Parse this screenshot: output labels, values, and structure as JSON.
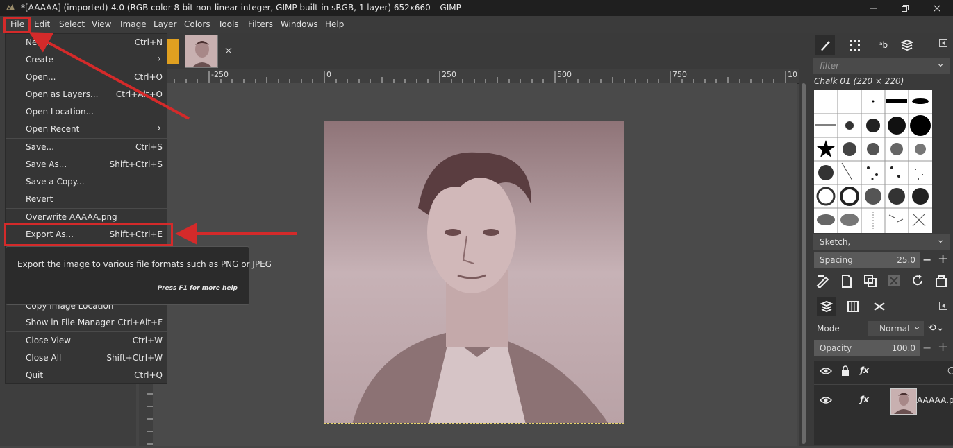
{
  "window": {
    "title": "*[AAAAA] (imported)-4.0 (RGB color 8-bit non-linear integer, GIMP built-in sRGB, 1 layer) 652x660 – GIMP"
  },
  "menubar": [
    "File",
    "Edit",
    "Select",
    "View",
    "Image",
    "Layer",
    "Colors",
    "Tools",
    "Filters",
    "Windows",
    "Help"
  ],
  "file_menu": {
    "items": [
      {
        "label": "New...",
        "shortcut": "Ctrl+N"
      },
      {
        "label": "Create",
        "shortcut": "",
        "submenu": true
      },
      {
        "label": "Open...",
        "shortcut": "Ctrl+O"
      },
      {
        "label": "Open as Layers...",
        "shortcut": "Ctrl+Alt+O"
      },
      {
        "label": "Open Location...",
        "shortcut": ""
      },
      {
        "label": "Open Recent",
        "shortcut": "",
        "submenu": true
      },
      {
        "label": "Save...",
        "shortcut": "Ctrl+S"
      },
      {
        "label": "Save As...",
        "shortcut": "Shift+Ctrl+S"
      },
      {
        "label": "Save a Copy...",
        "shortcut": ""
      },
      {
        "label": "Revert",
        "shortcut": ""
      },
      {
        "label": "Overwrite AAAAA.png",
        "shortcut": ""
      },
      {
        "label": "Export As...",
        "shortcut": "Shift+Ctrl+E"
      },
      {
        "label": "Copy Image Location",
        "shortcut": ""
      },
      {
        "label": "Show in File Manager",
        "shortcut": "Ctrl+Alt+F"
      },
      {
        "label": "Close View",
        "shortcut": "Ctrl+W"
      },
      {
        "label": "Close All",
        "shortcut": "Shift+Ctrl+W"
      },
      {
        "label": "Quit",
        "shortcut": "Ctrl+Q"
      }
    ]
  },
  "tooltip": {
    "text": "Export the image to various file formats such as PNG or JPEG",
    "help": "Press F1 for more help"
  },
  "ruler": [
    "-250",
    "0",
    "250",
    "500",
    "750",
    "10"
  ],
  "brushes": {
    "filter_placeholder": "filter",
    "selected_brush": "Chalk 01 (220 × 220)",
    "tag": "Sketch,",
    "spacing_label": "Spacing",
    "spacing_value": "25.0"
  },
  "layers": {
    "mode_label": "Mode",
    "mode_value": "Normal",
    "opacity_label": "Opacity",
    "opacity_value": "100.0",
    "layer_name": "AAAAA.p"
  },
  "colors": {
    "highlight": "#d42a2a",
    "selection_border": "#e6d36a"
  }
}
